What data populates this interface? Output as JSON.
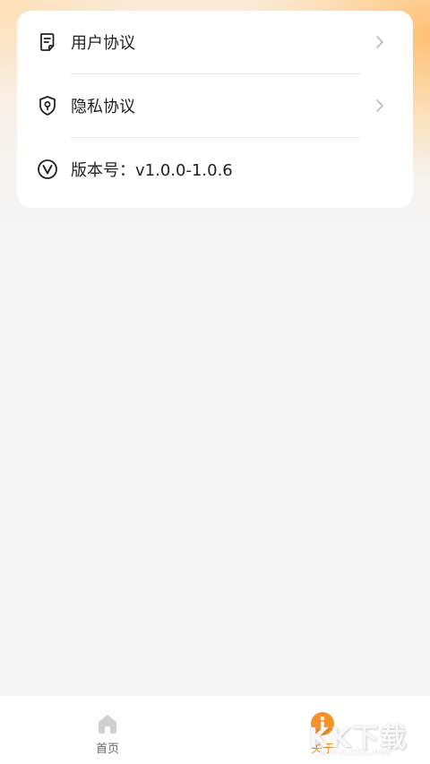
{
  "settings": {
    "items": [
      {
        "label": "用户协议",
        "icon": "document-icon"
      },
      {
        "label": "隐私协议",
        "icon": "shield-icon"
      },
      {
        "label": "版本号：v1.0.0-1.0.6",
        "icon": "version-icon"
      }
    ]
  },
  "tabbar": {
    "tabs": [
      {
        "label": "首页",
        "icon": "home-icon",
        "active": false
      },
      {
        "label": "关于",
        "icon": "info-icon",
        "active": true
      }
    ]
  },
  "watermark": {
    "text": "KK下载",
    "url": "www.kkx.net"
  },
  "colors": {
    "accent": "#f5932a",
    "inactive": "#666666",
    "card": "#ffffff",
    "background": "#f5f5f5"
  }
}
